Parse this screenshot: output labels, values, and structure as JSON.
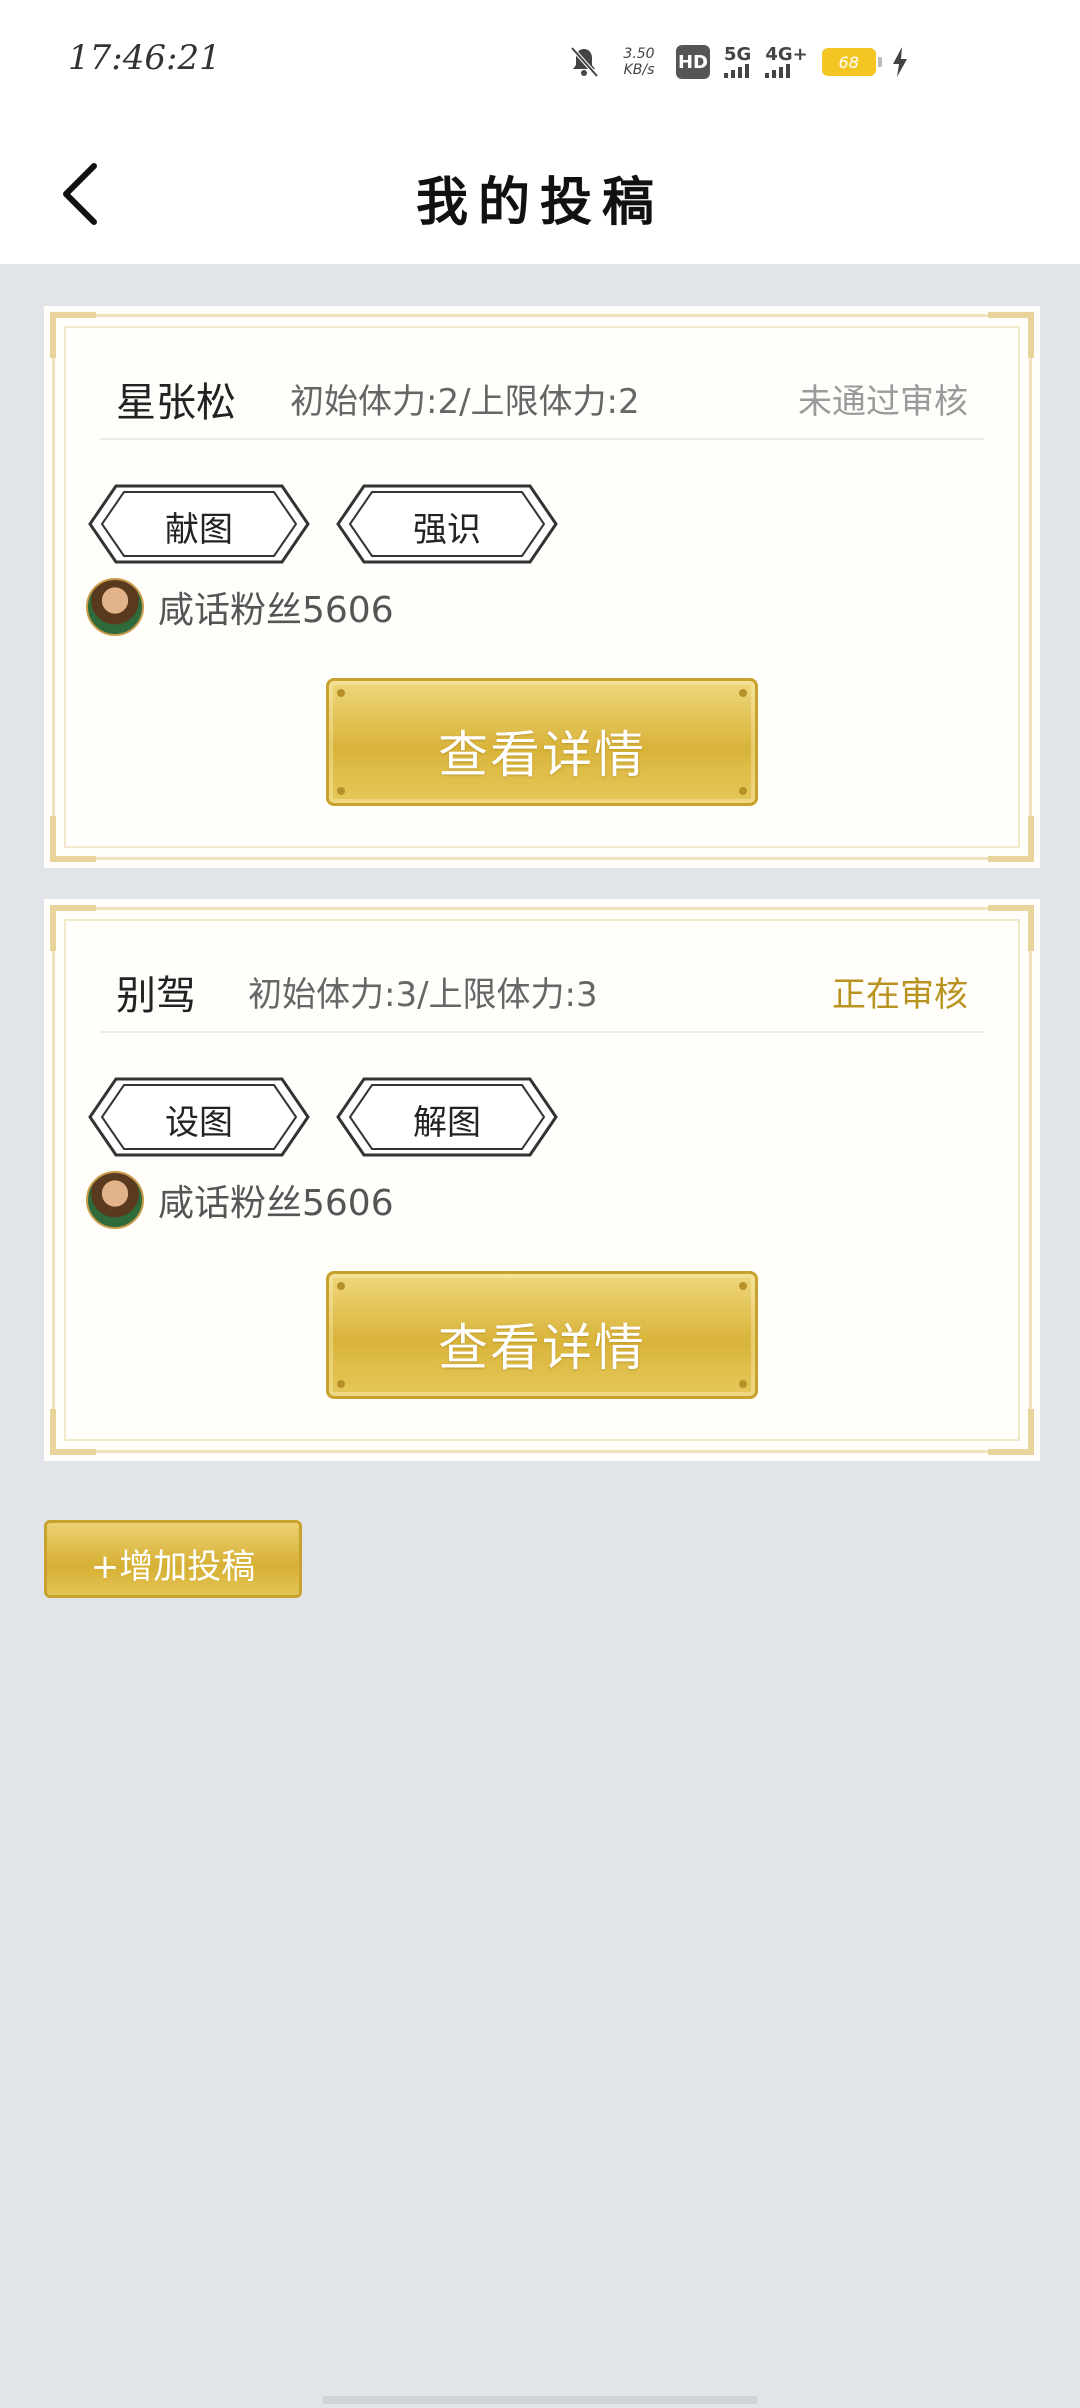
{
  "status_bar": {
    "time": "17:46:21",
    "net_speed_value": "3.50",
    "net_speed_unit": "KB/s",
    "hd_label": "HD",
    "sim1": "5G",
    "sim2": "4G+",
    "battery": "68"
  },
  "header": {
    "title": "我的投稿"
  },
  "cards": [
    {
      "name": "星张松",
      "stats": "初始体力:2/上限体力:2",
      "status": "未通过审核",
      "status_color": "#9a9a9a",
      "tags": [
        "献图",
        "强识"
      ],
      "author": "咸话粉丝5606",
      "button": "查看详情"
    },
    {
      "name": "别驾",
      "stats": "初始体力:3/上限体力:3",
      "status": "正在审核",
      "status_color": "#b8931f",
      "tags": [
        "设图",
        "解图"
      ],
      "author": "咸话粉丝5606",
      "button": "查看详情"
    }
  ],
  "add_button": "+增加投稿"
}
